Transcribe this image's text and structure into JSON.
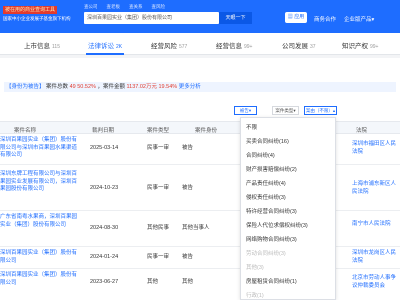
{
  "header": {
    "logo_line1": "被在用的商业查询工具",
    "logo_line2": "国家中小企业发展子基金旗下机构",
    "mini_tabs": [
      "查公司",
      "查老板",
      "查关系",
      "查风险"
    ],
    "search_value": "深圳百果园实业（集团）股份有限公司",
    "search_button": "天眼一下",
    "apply_label": "应用",
    "nav": [
      "商务合作",
      "企业版产品"
    ]
  },
  "subnav": [
    {
      "label": "上市信息",
      "count": "115"
    },
    {
      "label": "法律诉讼",
      "count": "2K"
    },
    {
      "label": "经营风险",
      "count": "577"
    },
    {
      "label": "经营信息",
      "count": "99+"
    },
    {
      "label": "公司发展",
      "count": "37"
    },
    {
      "label": "知识产权",
      "count": "99+"
    }
  ],
  "summary": {
    "role": "【身份为被告】",
    "text1": "案件总数",
    "count": "49",
    "pct1": "50.52%",
    "text2": "，案件金额",
    "amount": "1137.02万元",
    "pct2": "19.54%",
    "more": "更多分析"
  },
  "filters": {
    "status": "被告",
    "case_type": "案件类型",
    "reason": "案由（不限）"
  },
  "table": {
    "headers": [
      "案件名称",
      "裁判日期",
      "案件类型",
      "案件身份",
      "法院"
    ],
    "rows": [
      {
        "name": "深圳百果园实业（集团）股份有限公司与深圳市百果园水果渠道有限公司",
        "date": "2025-03-14",
        "type": "民事一审",
        "role": "被告",
        "court": "深圳市福田区人民法院"
      },
      {
        "name": "深圳东牌工程有限公司与深圳百果园实业发展有限公司，深圳百果园股份有限公司",
        "date": "2024-10-23",
        "type": "民事一审",
        "role": "被告",
        "court": "上海市浦东新区人民法院"
      },
      {
        "name": "广东省南粤水果商，深圳百果园实业（集团）股份有限公司",
        "date": "2024-08-30",
        "type": "其他民事",
        "role": "其他当事人",
        "court": "南宁市人民法院"
      },
      {
        "name": "深圳百果园实业（集团）股份有限公司",
        "date": "2024-01-24",
        "type": "民事一审",
        "role": "被告",
        "court": "深圳市龙岗区人民法院"
      },
      {
        "name": "深圳百果园实业（集团）股份有限公司",
        "date": "2023-06-27",
        "type": "其他",
        "role": "其他",
        "court": "北京市劳动人事争议仲裁委员会"
      }
    ]
  },
  "dropdown": [
    {
      "label": "不限",
      "count": ""
    },
    {
      "label": "买卖合同纠纷",
      "count": "(16)"
    },
    {
      "label": "合同纠纷",
      "count": "(4)"
    },
    {
      "label": "财产损害赔偿纠纷",
      "count": "(2)"
    },
    {
      "label": "产品责任纠纷",
      "count": "(4)"
    },
    {
      "label": "侵权责任纠纷",
      "count": "(3)"
    },
    {
      "label": "特许经营合同纠纷",
      "count": "(3)"
    },
    {
      "label": "保险人代位求偿权纠纷",
      "count": "(3)"
    },
    {
      "label": "网络购物合同纠纷",
      "count": "(3)"
    },
    {
      "label": "劳动合同纠纷",
      "count": "(3)"
    },
    {
      "label": "其他",
      "count": "(3)"
    },
    {
      "label": "房屋租赁合同纠纷",
      "count": "(1)"
    },
    {
      "label": "行政",
      "count": "(1)"
    }
  ]
}
